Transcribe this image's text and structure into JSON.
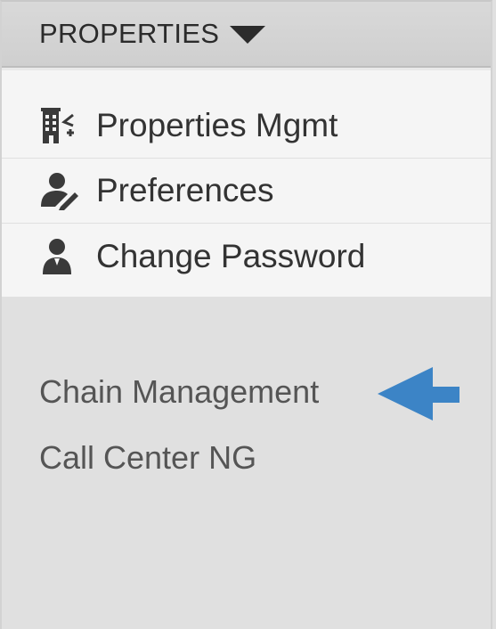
{
  "header": {
    "title": "PROPERTIES",
    "caret_icon": "caret-down-icon"
  },
  "menu": {
    "items": [
      {
        "label": "Properties Mgmt",
        "icon": "building-icon"
      },
      {
        "label": "Preferences",
        "icon": "user-edit-icon"
      },
      {
        "label": "Change Password",
        "icon": "user-icon"
      }
    ]
  },
  "links": [
    {
      "label": "Chain Management"
    },
    {
      "label": "Call Center NG"
    }
  ],
  "annotation": {
    "arrow_icon": "left-arrow-icon",
    "arrow_color": "#3c84c6"
  },
  "colors": {
    "header_bg": "#d2d2d2",
    "menu_bg": "#f5f5f5",
    "panel_bg": "#e0e0e0",
    "text": "#333333"
  }
}
